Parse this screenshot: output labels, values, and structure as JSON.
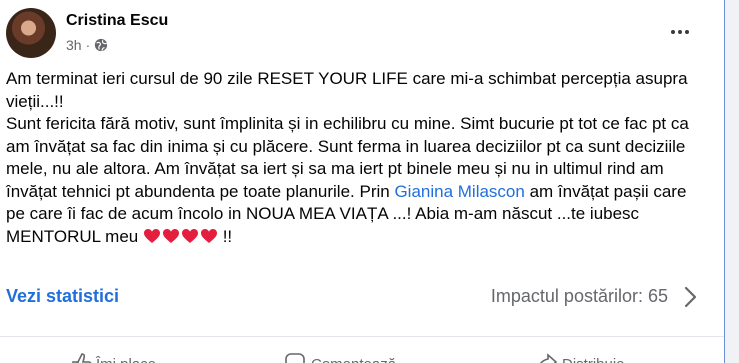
{
  "post": {
    "author": "Cristina Escu",
    "time": "3h",
    "visibility_icon": "globe-icon",
    "text_line1": "Am terminat ieri cursul de 90 zile RESET YOUR LIFE care mi-a schimbat percepția asupra vieții...!!",
    "text_part2a": "Sunt fericita fără motiv, sunt împlinita și in echilibru cu mine. Simt bucurie pt tot ce fac pt ca am învățat sa fac din inima și cu plăcere. Sunt ferma in luarea deciziilor pt ca sunt deciziile mele, nu ale altora. Am învățat sa iert și sa ma iert pt binele meu și nu in ultimul rind am învățat tehnici pt abundenta pe toate planurile. Prin ",
    "mention": "Gianina Milascon",
    "text_part2b": " am învățat pașii care pe care îi fac de acum încolo in NOUA MEA VIAȚA ...! Abia m-am născut ...te iubesc MENTORUL meu ",
    "text_end": " !!",
    "hearts_count": 4,
    "heart_color": "#e41e3f"
  },
  "footer": {
    "stats_link": "Vezi statistici",
    "impact_label": "Impactul postărilor: 65"
  },
  "colors": {
    "link": "#216fdb",
    "muted": "#65676b",
    "text": "#050505"
  }
}
